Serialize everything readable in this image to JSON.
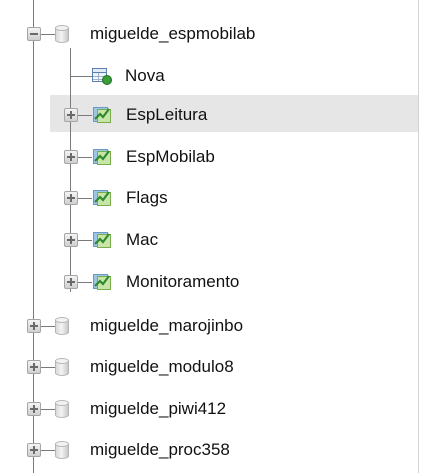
{
  "tree": {
    "expanded_db": {
      "label": "miguelde_espmobilab",
      "icon": "database-icon",
      "expander": "minus",
      "children": [
        {
          "label": "Nova",
          "icon": "new-table-icon",
          "kind": "new"
        },
        {
          "label": "EspLeitura",
          "icon": "table-icon",
          "kind": "table",
          "highlighted": true
        },
        {
          "label": "EspMobilab",
          "icon": "table-icon",
          "kind": "table"
        },
        {
          "label": "Flags",
          "icon": "table-icon",
          "kind": "table"
        },
        {
          "label": "Mac",
          "icon": "table-icon",
          "kind": "table"
        },
        {
          "label": "Monitoramento",
          "icon": "table-icon",
          "kind": "table"
        }
      ]
    },
    "collapsed_dbs": [
      {
        "label": "miguelde_marojinbo",
        "icon": "database-icon",
        "expander": "plus"
      },
      {
        "label": "miguelde_modulo8",
        "icon": "database-icon",
        "expander": "plus"
      },
      {
        "label": "miguelde_piwi412",
        "icon": "database-icon",
        "expander": "plus"
      },
      {
        "label": "miguelde_proc358",
        "icon": "database-icon",
        "expander": "plus"
      }
    ]
  },
  "colors": {
    "highlight": "#e6e6e6",
    "tree_line": "#7a7a7a",
    "text": "#111111"
  }
}
